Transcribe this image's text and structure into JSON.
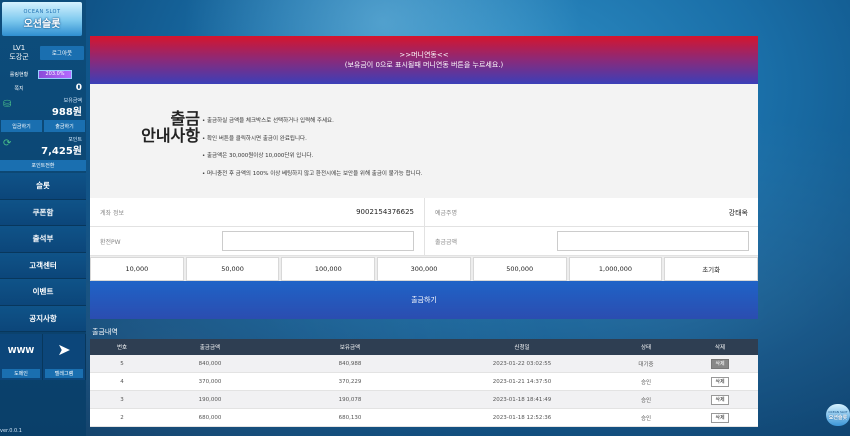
{
  "logo": {
    "sub": "OCEAN SLOT",
    "main": "오션슬롯"
  },
  "user": {
    "level": "LV1",
    "name": "도강군",
    "logout": "로그아웃"
  },
  "betting": {
    "label": "롤링현황",
    "percent_text": "203.0%",
    "progress": 1.0
  },
  "notice": {
    "label": "쪽지",
    "count": "0"
  },
  "balance": {
    "label": "보유금액",
    "amount": "988원"
  },
  "money_buttons": {
    "deposit": "입금하기",
    "withdraw": "출금하기"
  },
  "point": {
    "label": "포인트",
    "amount": "7,425원",
    "convert": "포인트전환"
  },
  "menu": [
    "슬롯",
    "쿠폰함",
    "출석부",
    "고객센터",
    "이벤트",
    "공지사항"
  ],
  "quick": [
    {
      "icon": "www-icon",
      "glyph": "WWW",
      "label": "도메인"
    },
    {
      "icon": "telegram-icon",
      "glyph": "➤",
      "label": "텔레그램"
    }
  ],
  "version": "ver.0.0.1",
  "banner": {
    "line1": ">>머니연동<<",
    "line2": "(보유금이 0으로 표시될때 머니연동 버튼을 누르세요.)"
  },
  "guide": {
    "title_line1": "출금",
    "title_line2": "안내사항",
    "items": [
      "• 출금하실 금액을 체크박스로 선택하거나 입력해 주세요.",
      "• 확인 버튼을 클릭하시면 출금이 완료됩니다.",
      "• 출금액은 30,000원이상 10,000단위 입니다.",
      "• 머니충전 후 금액의 100% 이상 베팅하지 않고 환전시에는 보안을 위해 출금이 불가능 합니다."
    ]
  },
  "form": {
    "account_label": "계좌 정보",
    "account_value": "9002154376625",
    "holder_label": "예금주명",
    "holder_value": "강태옥",
    "pw_label": "환전PW",
    "amount_label": "출금금액"
  },
  "amount_buttons": [
    "10,000",
    "50,000",
    "100,000",
    "300,000",
    "500,000",
    "1,000,000",
    "초기화"
  ],
  "submit_label": "출금하기",
  "history": {
    "title": "출금내역",
    "headers": [
      "번호",
      "출금금액",
      "보유금액",
      "신청일",
      "상태",
      "삭제"
    ],
    "rows": [
      {
        "no": "5",
        "amount": "840,000",
        "balance": "840,988",
        "date": "2023-01-22 03:02:55",
        "status": "대기중",
        "del": "삭제"
      },
      {
        "no": "4",
        "amount": "370,000",
        "balance": "370,229",
        "date": "2023-01-21 14:37:50",
        "status": "승인",
        "del": "삭제"
      },
      {
        "no": "3",
        "amount": "190,000",
        "balance": "190,078",
        "date": "2023-01-18 18:41:49",
        "status": "승인",
        "del": "삭제"
      },
      {
        "no": "2",
        "amount": "680,000",
        "balance": "680,130",
        "date": "2023-01-18 12:52:36",
        "status": "승인",
        "del": "삭제"
      }
    ]
  },
  "badge": {
    "sub": "OCEAN SLOT",
    "main": "오션슬롯"
  }
}
